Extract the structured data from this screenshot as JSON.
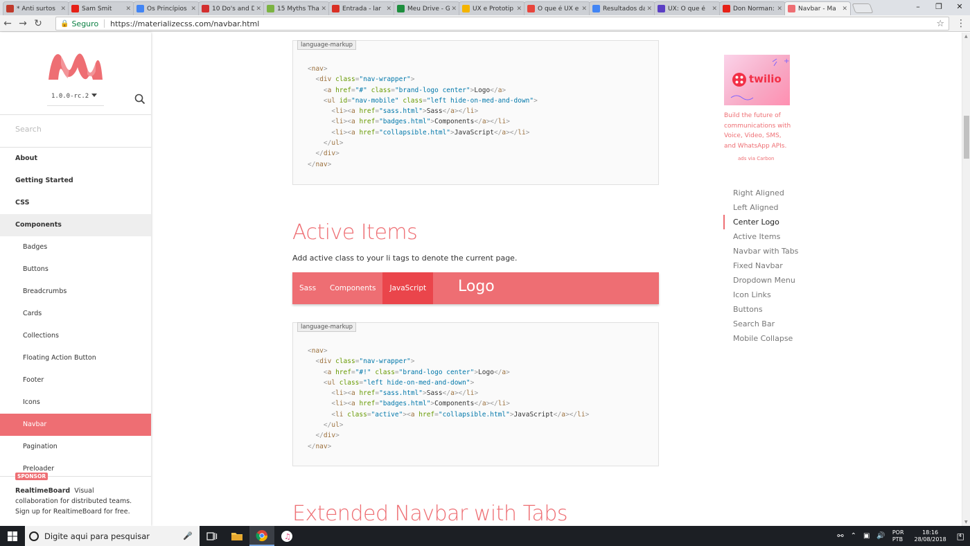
{
  "browser": {
    "tabs": [
      {
        "title": "* Anti surtos",
        "color": "#c0392b",
        "active": false
      },
      {
        "title": "Sam Smit",
        "color": "#e62117",
        "active": false
      },
      {
        "title": "Os Princípios",
        "color": "#4285f4",
        "active": false
      },
      {
        "title": "10 Do's and D",
        "color": "#d32f2f",
        "active": false
      },
      {
        "title": "15 Myths Tha",
        "color": "#7cb342",
        "active": false
      },
      {
        "title": "Entrada - lar",
        "color": "#d93025",
        "active": false
      },
      {
        "title": "Meu Drive - G",
        "color": "#1e8e3e",
        "active": false
      },
      {
        "title": "UX e Prototip",
        "color": "#f4b400",
        "active": false
      },
      {
        "title": "O que é UX e",
        "color": "#e8453c",
        "active": false
      },
      {
        "title": "Resultados da",
        "color": "#4285f4",
        "active": false
      },
      {
        "title": "UX: O que é ",
        "color": "#5b3fc4",
        "active": false
      },
      {
        "title": "Don Norman:",
        "color": "#e62117",
        "active": false
      },
      {
        "title": "Navbar - Ma",
        "color": "#ee6e73",
        "active": true
      }
    ],
    "secure_label": "Seguro",
    "url": "https://materializecss.com/navbar.html"
  },
  "sidebar": {
    "version": "1.0.0-rc.2",
    "search_placeholder": "Search",
    "items": [
      {
        "label": "About",
        "type": "top",
        "state": ""
      },
      {
        "label": "Getting Started",
        "type": "top",
        "state": ""
      },
      {
        "label": "CSS",
        "type": "top",
        "state": ""
      },
      {
        "label": "Components",
        "type": "top",
        "state": "grey"
      },
      {
        "label": "Badges",
        "type": "sub",
        "state": ""
      },
      {
        "label": "Buttons",
        "type": "sub",
        "state": ""
      },
      {
        "label": "Breadcrumbs",
        "type": "sub",
        "state": ""
      },
      {
        "label": "Cards",
        "type": "sub",
        "state": ""
      },
      {
        "label": "Collections",
        "type": "sub",
        "state": ""
      },
      {
        "label": "Floating Action Button",
        "type": "sub",
        "state": ""
      },
      {
        "label": "Footer",
        "type": "sub",
        "state": ""
      },
      {
        "label": "Icons",
        "type": "sub",
        "state": ""
      },
      {
        "label": "Navbar",
        "type": "sub",
        "state": "active"
      },
      {
        "label": "Pagination",
        "type": "sub",
        "state": ""
      },
      {
        "label": "Preloader",
        "type": "sub",
        "state": ""
      }
    ],
    "sponsor": {
      "badge": "SPONSOR",
      "name": "RealtimeBoard",
      "text": "Visual collaboration for distributed teams. Sign up for RealtimeBoard for free."
    }
  },
  "main": {
    "code_tag": "language-markup",
    "code1": [
      [
        [
          "p",
          "<"
        ],
        [
          "t",
          "nav"
        ],
        [
          "p",
          ">"
        ]
      ],
      [
        [
          "x",
          "  "
        ],
        [
          "p",
          "<"
        ],
        [
          "t",
          "div "
        ],
        [
          "a",
          "class"
        ],
        [
          "p",
          "="
        ],
        [
          "v",
          "\"nav-wrapper\""
        ],
        [
          "p",
          ">"
        ]
      ],
      [
        [
          "x",
          "    "
        ],
        [
          "p",
          "<"
        ],
        [
          "t",
          "a "
        ],
        [
          "a",
          "href"
        ],
        [
          "p",
          "="
        ],
        [
          "v",
          "\"#\" "
        ],
        [
          "a",
          "class"
        ],
        [
          "p",
          "="
        ],
        [
          "v",
          "\"brand-logo center\""
        ],
        [
          "p",
          ">"
        ],
        [
          "x",
          "Logo"
        ],
        [
          "p",
          "</"
        ],
        [
          "t",
          "a"
        ],
        [
          "p",
          ">"
        ]
      ],
      [
        [
          "x",
          "    "
        ],
        [
          "p",
          "<"
        ],
        [
          "t",
          "ul "
        ],
        [
          "a",
          "id"
        ],
        [
          "p",
          "="
        ],
        [
          "v",
          "\"nav-mobile\" "
        ],
        [
          "a",
          "class"
        ],
        [
          "p",
          "="
        ],
        [
          "v",
          "\"left hide-on-med-and-down\""
        ],
        [
          "p",
          ">"
        ]
      ],
      [
        [
          "x",
          "      "
        ],
        [
          "p",
          "<"
        ],
        [
          "t",
          "li"
        ],
        [
          "p",
          ">"
        ],
        [
          "p",
          "<"
        ],
        [
          "t",
          "a "
        ],
        [
          "a",
          "href"
        ],
        [
          "p",
          "="
        ],
        [
          "v",
          "\"sass.html\""
        ],
        [
          "p",
          ">"
        ],
        [
          "x",
          "Sass"
        ],
        [
          "p",
          "</"
        ],
        [
          "t",
          "a"
        ],
        [
          "p",
          ">"
        ],
        [
          "p",
          "</"
        ],
        [
          "t",
          "li"
        ],
        [
          "p",
          ">"
        ]
      ],
      [
        [
          "x",
          "      "
        ],
        [
          "p",
          "<"
        ],
        [
          "t",
          "li"
        ],
        [
          "p",
          ">"
        ],
        [
          "p",
          "<"
        ],
        [
          "t",
          "a "
        ],
        [
          "a",
          "href"
        ],
        [
          "p",
          "="
        ],
        [
          "v",
          "\"badges.html\""
        ],
        [
          "p",
          ">"
        ],
        [
          "x",
          "Components"
        ],
        [
          "p",
          "</"
        ],
        [
          "t",
          "a"
        ],
        [
          "p",
          ">"
        ],
        [
          "p",
          "</"
        ],
        [
          "t",
          "li"
        ],
        [
          "p",
          ">"
        ]
      ],
      [
        [
          "x",
          "      "
        ],
        [
          "p",
          "<"
        ],
        [
          "t",
          "li"
        ],
        [
          "p",
          ">"
        ],
        [
          "p",
          "<"
        ],
        [
          "t",
          "a "
        ],
        [
          "a",
          "href"
        ],
        [
          "p",
          "="
        ],
        [
          "v",
          "\"collapsible.html\""
        ],
        [
          "p",
          ">"
        ],
        [
          "x",
          "JavaScript"
        ],
        [
          "p",
          "</"
        ],
        [
          "t",
          "a"
        ],
        [
          "p",
          ">"
        ],
        [
          "p",
          "</"
        ],
        [
          "t",
          "li"
        ],
        [
          "p",
          ">"
        ]
      ],
      [
        [
          "x",
          "    "
        ],
        [
          "p",
          "</"
        ],
        [
          "t",
          "ul"
        ],
        [
          "p",
          ">"
        ]
      ],
      [
        [
          "x",
          "  "
        ],
        [
          "p",
          "</"
        ],
        [
          "t",
          "div"
        ],
        [
          "p",
          ">"
        ]
      ],
      [
        [
          "p",
          "</"
        ],
        [
          "t",
          "nav"
        ],
        [
          "p",
          ">"
        ]
      ]
    ],
    "active_items_title": "Active Items",
    "active_items_desc": "Add active class to your li tags to denote the current page.",
    "demo_nav": {
      "links": [
        {
          "label": "Sass",
          "active": false
        },
        {
          "label": "Components",
          "active": false
        },
        {
          "label": "JavaScript",
          "active": true
        }
      ],
      "logo": "Logo"
    },
    "code2": [
      [
        [
          "p",
          "<"
        ],
        [
          "t",
          "nav"
        ],
        [
          "p",
          ">"
        ]
      ],
      [
        [
          "x",
          "  "
        ],
        [
          "p",
          "<"
        ],
        [
          "t",
          "div "
        ],
        [
          "a",
          "class"
        ],
        [
          "p",
          "="
        ],
        [
          "v",
          "\"nav-wrapper\""
        ],
        [
          "p",
          ">"
        ]
      ],
      [
        [
          "x",
          "    "
        ],
        [
          "p",
          "<"
        ],
        [
          "t",
          "a "
        ],
        [
          "a",
          "href"
        ],
        [
          "p",
          "="
        ],
        [
          "v",
          "\"#!\" "
        ],
        [
          "a",
          "class"
        ],
        [
          "p",
          "="
        ],
        [
          "v",
          "\"brand-logo center\""
        ],
        [
          "p",
          ">"
        ],
        [
          "x",
          "Logo"
        ],
        [
          "p",
          "</"
        ],
        [
          "t",
          "a"
        ],
        [
          "p",
          ">"
        ]
      ],
      [
        [
          "x",
          "    "
        ],
        [
          "p",
          "<"
        ],
        [
          "t",
          "ul "
        ],
        [
          "a",
          "class"
        ],
        [
          "p",
          "="
        ],
        [
          "v",
          "\"left hide-on-med-and-down\""
        ],
        [
          "p",
          ">"
        ]
      ],
      [
        [
          "x",
          "      "
        ],
        [
          "p",
          "<"
        ],
        [
          "t",
          "li"
        ],
        [
          "p",
          ">"
        ],
        [
          "p",
          "<"
        ],
        [
          "t",
          "a "
        ],
        [
          "a",
          "href"
        ],
        [
          "p",
          "="
        ],
        [
          "v",
          "\"sass.html\""
        ],
        [
          "p",
          ">"
        ],
        [
          "x",
          "Sass"
        ],
        [
          "p",
          "</"
        ],
        [
          "t",
          "a"
        ],
        [
          "p",
          ">"
        ],
        [
          "p",
          "</"
        ],
        [
          "t",
          "li"
        ],
        [
          "p",
          ">"
        ]
      ],
      [
        [
          "x",
          "      "
        ],
        [
          "p",
          "<"
        ],
        [
          "t",
          "li"
        ],
        [
          "p",
          ">"
        ],
        [
          "p",
          "<"
        ],
        [
          "t",
          "a "
        ],
        [
          "a",
          "href"
        ],
        [
          "p",
          "="
        ],
        [
          "v",
          "\"badges.html\""
        ],
        [
          "p",
          ">"
        ],
        [
          "x",
          "Components"
        ],
        [
          "p",
          "</"
        ],
        [
          "t",
          "a"
        ],
        [
          "p",
          ">"
        ],
        [
          "p",
          "</"
        ],
        [
          "t",
          "li"
        ],
        [
          "p",
          ">"
        ]
      ],
      [
        [
          "x",
          "      "
        ],
        [
          "p",
          "<"
        ],
        [
          "t",
          "li "
        ],
        [
          "a",
          "class"
        ],
        [
          "p",
          "="
        ],
        [
          "v",
          "\"active\""
        ],
        [
          "p",
          ">"
        ],
        [
          "p",
          "<"
        ],
        [
          "t",
          "a "
        ],
        [
          "a",
          "href"
        ],
        [
          "p",
          "="
        ],
        [
          "v",
          "\"collapsible.html\""
        ],
        [
          "p",
          ">"
        ],
        [
          "x",
          "JavaScript"
        ],
        [
          "p",
          "</"
        ],
        [
          "t",
          "a"
        ],
        [
          "p",
          ">"
        ],
        [
          "p",
          "</"
        ],
        [
          "t",
          "li"
        ],
        [
          "p",
          ">"
        ]
      ],
      [
        [
          "x",
          "    "
        ],
        [
          "p",
          "</"
        ],
        [
          "t",
          "ul"
        ],
        [
          "p",
          ">"
        ]
      ],
      [
        [
          "x",
          "  "
        ],
        [
          "p",
          "</"
        ],
        [
          "t",
          "div"
        ],
        [
          "p",
          ">"
        ]
      ],
      [
        [
          "p",
          "</"
        ],
        [
          "t",
          "nav"
        ],
        [
          "p",
          ">"
        ]
      ]
    ],
    "extended_title": "Extended Navbar with Tabs"
  },
  "ad": {
    "brand": "twilio",
    "text": "Build the future of communications with Voice, Video, SMS, and WhatsApp APIs.",
    "via": "ads via Carbon"
  },
  "toc": {
    "items": [
      "Right Aligned",
      "Left Aligned",
      "Center Logo",
      "Active Items",
      "Navbar with Tabs",
      "Fixed Navbar",
      "Dropdown Menu",
      "Icon Links",
      "Buttons",
      "Search Bar",
      "Mobile Collapse"
    ],
    "active": "Center Logo"
  },
  "taskbar": {
    "search_placeholder": "Digite aqui para pesquisar",
    "lang_top": "POR",
    "lang_bottom": "PTB",
    "time": "18:16",
    "date": "28/08/2018",
    "notifications": "4"
  },
  "colors": {
    "brand": "#ee6e73",
    "active_link": "#ea454b"
  }
}
